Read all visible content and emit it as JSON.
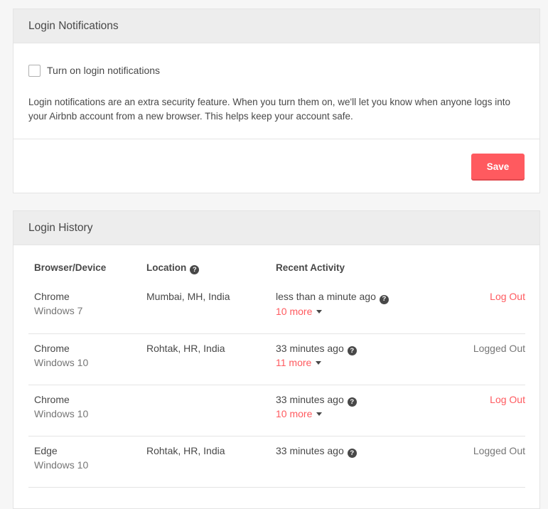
{
  "notifications": {
    "title": "Login Notifications",
    "checkbox_label": "Turn on login notifications",
    "description": "Login notifications are an extra security feature. When you turn them on, we'll let you know when anyone logs into your Airbnb account from a new browser. This helps keep your account safe.",
    "save_label": "Save"
  },
  "history": {
    "title": "Login History",
    "columns": {
      "browser": "Browser/Device",
      "location": "Location",
      "activity": "Recent Activity"
    },
    "rows": [
      {
        "browser": "Chrome",
        "os": "Windows 7",
        "location": "Mumbai, MH, India",
        "activity": "less than a minute ago",
        "more": "10 more",
        "action": "Log Out"
      },
      {
        "browser": "Chrome",
        "os": "Windows 10",
        "location": "Rohtak, HR, India",
        "activity": "33 minutes ago",
        "more": "11 more",
        "action": "Logged Out"
      },
      {
        "browser": "Chrome",
        "os": "Windows 10",
        "location": "",
        "activity": "33 minutes ago",
        "more": "10 more",
        "action": "Log Out"
      },
      {
        "browser": "Edge",
        "os": "Windows 10",
        "location": "Rohtak, HR, India",
        "activity": "33 minutes ago",
        "more": "",
        "action": "Logged Out"
      }
    ]
  },
  "icons": {
    "help": "question-circle-icon",
    "dropdown": "caret-down-icon"
  },
  "colors": {
    "accent": "#ff5a5f",
    "text": "#484848",
    "muted": "#767676"
  }
}
